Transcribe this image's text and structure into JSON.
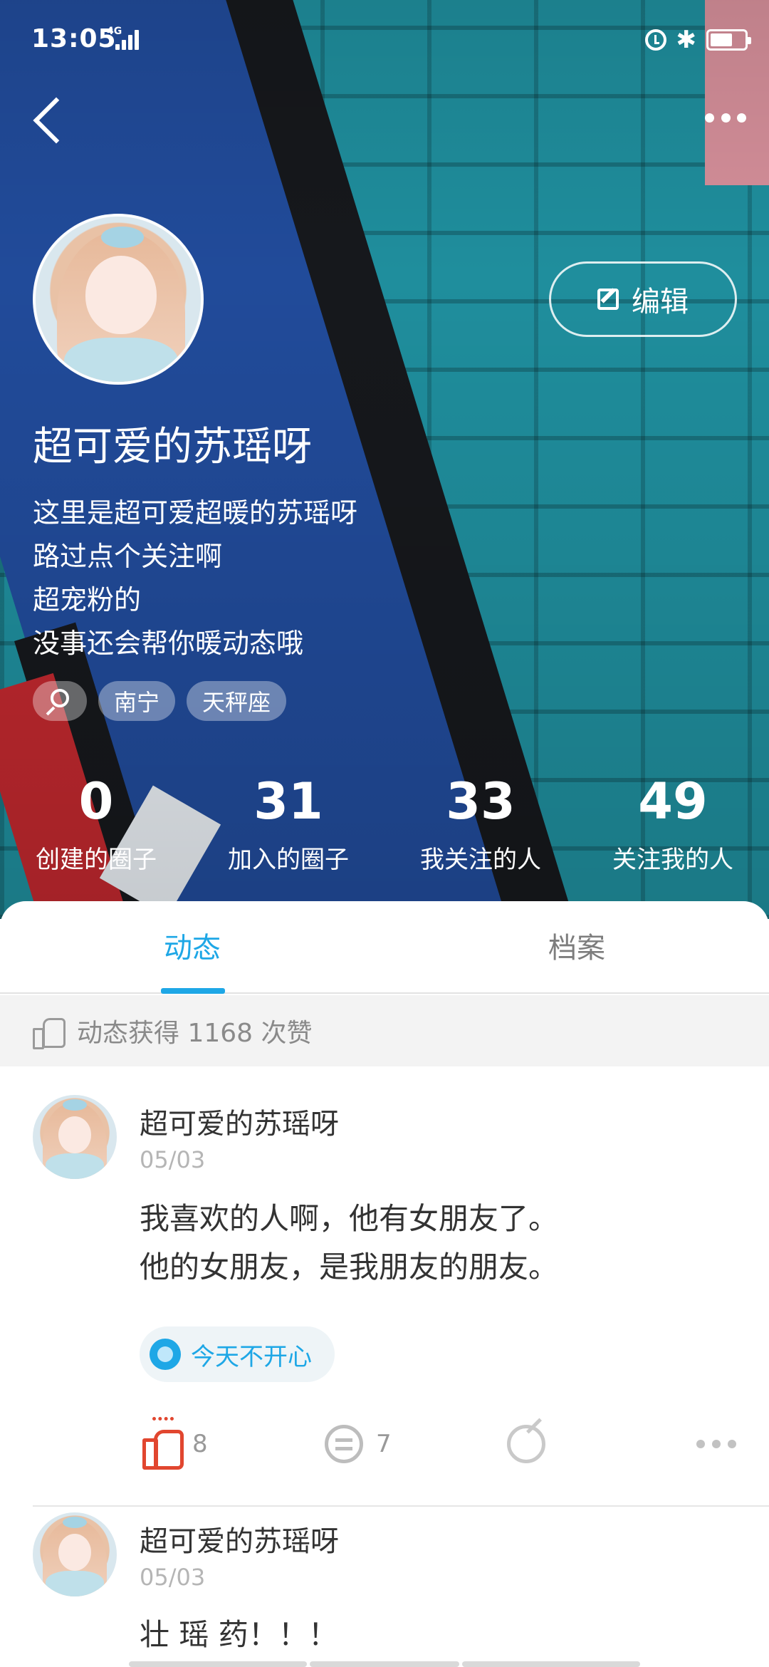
{
  "status_bar": {
    "time": "13:05",
    "network": "4G"
  },
  "header": {
    "back_icon": "chevron-left-icon",
    "more_icon": "ellipsis-icon",
    "edit_label": "编辑"
  },
  "profile": {
    "name": "超可爱的苏瑶呀",
    "bio": [
      "这里是超可爱超暖的苏瑶呀",
      "路过点个关注啊",
      "超宠粉的",
      "没事还会帮你暖动态哦"
    ],
    "tags": [
      "南宁",
      "天秤座"
    ]
  },
  "stats": [
    {
      "value": "0",
      "label": "创建的圈子"
    },
    {
      "value": "31",
      "label": "加入的圈子"
    },
    {
      "value": "33",
      "label": "我关注的人"
    },
    {
      "value": "49",
      "label": "关注我的人"
    }
  ],
  "tabs": [
    {
      "label": "动态",
      "active": true
    },
    {
      "label": "档案",
      "active": false
    }
  ],
  "likes_summary": "动态获得 1168 次赞",
  "posts": [
    {
      "author": "超可爱的苏瑶呀",
      "date": "05/03",
      "lines": [
        "我喜欢的人啊，他有女朋友了。",
        "他的女朋友，是我朋友的朋友。"
      ],
      "mood": "今天不开心",
      "likes": "8",
      "comments": "7"
    },
    {
      "author": "超可爱的苏瑶呀",
      "date": "05/03",
      "lines": [
        "壮 瑶 药！！！"
      ]
    }
  ],
  "colors": {
    "accent": "#1ea7e6",
    "like": "#e1462f"
  }
}
